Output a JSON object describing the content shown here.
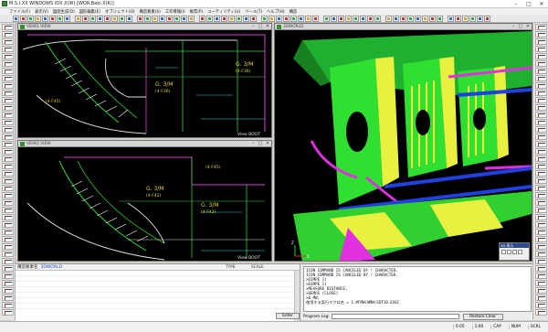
{
  "window": {
    "title": "M.S.I.XX WINDOWS IDX X(W)  [WOR.Baki.X(K)]",
    "minimize": "–",
    "maximize": "□",
    "close": "✕"
  },
  "menu": [
    "ファイル(F)",
    "表示(V)",
    "図面生成(D)",
    "図形編集(E)",
    "オブジェクト(O)",
    "構造要素(S)",
    "工作情報(I)",
    "帳票(P)",
    "ユーティリティ(U)",
    "ツール(T)",
    "ヘルプ(H)",
    "構造"
  ],
  "toolbar_colors": [
    "c1",
    "c2",
    "c3",
    "c4",
    "c1",
    "c2",
    "c3",
    "c1",
    "c4",
    "c2",
    "c3",
    "c1",
    "c2",
    "c4",
    "c3",
    "c1",
    "c2",
    "c3",
    "c4",
    "c1",
    "c2",
    "c3",
    "c1",
    "c4",
    "c2",
    "c3",
    "c1",
    "c2",
    "c4",
    "c3",
    "c1",
    "c2",
    "c3",
    "c4",
    "c1",
    "c2",
    "c3",
    "c1",
    "c4",
    "c2",
    "c3",
    "c1",
    "c2",
    "c4",
    "c3",
    "c1",
    "c2",
    "c3",
    "c4",
    "c1",
    "c2",
    "c3",
    "c1",
    "c4",
    "c2",
    "c3",
    "c1",
    "c2",
    "c4",
    "c3",
    "c1",
    "c2"
  ],
  "views": {
    "top_left": {
      "title": "VIEW1 VIEW",
      "label_a": "G. 3/M",
      "label_b": "(4-F36)",
      "label_c": "G. 3/M",
      "label_d": "(4-F36)",
      "label_e": "(4-F45)",
      "view_tag": "View  BOOT"
    },
    "bottom_left": {
      "title": "VIEW2 VIEW",
      "label_a": "G. 3/M",
      "label_b": "(4-F42)",
      "label_c": "G. 3/M",
      "label_d": "(4-F42)",
      "label_e": "(4-F45)",
      "view_tag": "View  BOOT"
    },
    "right": {
      "title": "3DWORLD"
    }
  },
  "bottom": {
    "struct_label": "構造要素名",
    "struct_value": "3DWORLD",
    "col_type": "TYPE",
    "col_scale": "SCALE",
    "enter": "Enter",
    "prog_label": "Program Log:",
    "restore": "Restore  Clear",
    "console_lines": [
      "ICON COMMAND IS CANCELED BY ! CHARACTER.",
      "ICON COMMAND IS CANCELED BY ! CHARACTER.",
      ">DIMPE 1(",
      ">DIMPE 1(",
      ">MEASURE DISTANCE;",
      ">DEMOS (CLOSE)",
      ">0 MW;",
      "使用する実行マクロ名 = 1:#FMW(WMW)SDT10.EXEC"
    ]
  },
  "minipanel": {
    "title": "3D 表示"
  },
  "status": [
    "0.05",
    "1:00",
    "CAP",
    "NUM",
    "SCRL"
  ]
}
